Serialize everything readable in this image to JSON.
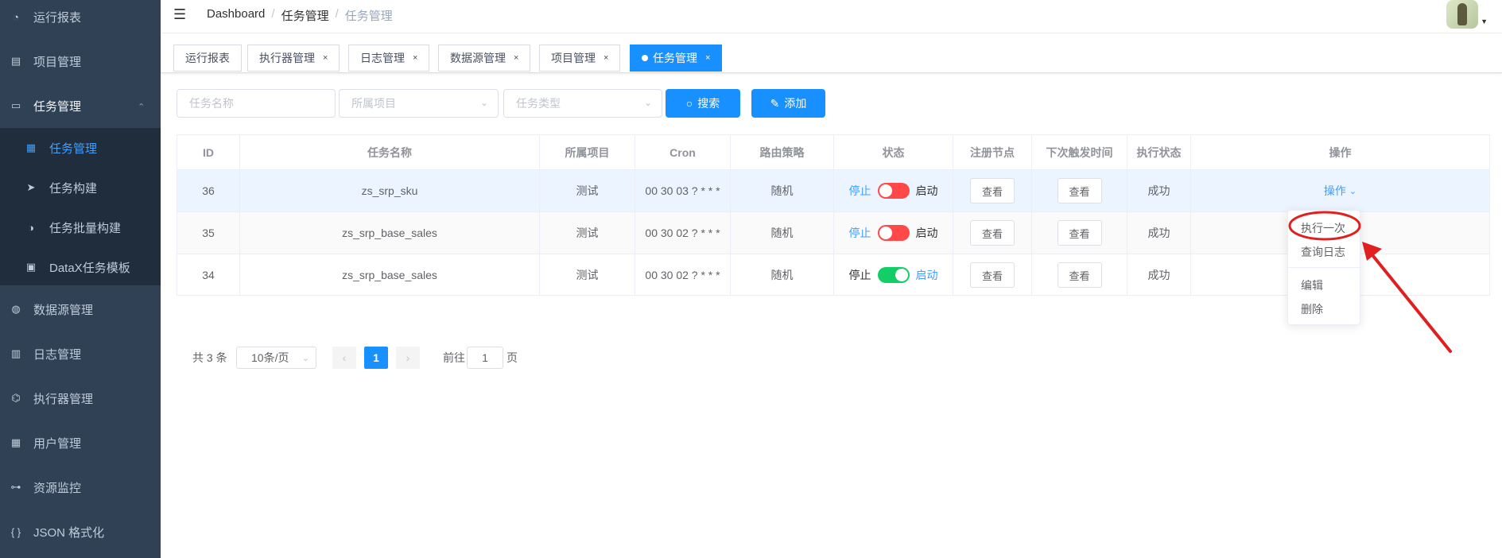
{
  "sidebar": {
    "items": [
      {
        "label": "运行报表",
        "icon": "dashboard-icon"
      },
      {
        "label": "项目管理",
        "icon": "database-icon"
      },
      {
        "label": "任务管理",
        "icon": "monitor-icon"
      },
      {
        "label": "数据源管理",
        "icon": "datasource-icon"
      },
      {
        "label": "日志管理",
        "icon": "log-icon"
      },
      {
        "label": "执行器管理",
        "icon": "executor-icon"
      },
      {
        "label": "用户管理",
        "icon": "table-icon"
      },
      {
        "label": "资源监控",
        "icon": "link-icon"
      },
      {
        "label": "JSON 格式化",
        "icon": "braces-icon"
      }
    ],
    "submenu": [
      {
        "label": "任务管理",
        "icon": "task-icon"
      },
      {
        "label": "任务构建",
        "icon": "send-icon"
      },
      {
        "label": "任务批量构建",
        "icon": "batch-icon"
      },
      {
        "label": "DataX任务模板",
        "icon": "template-icon"
      }
    ]
  },
  "navbar": {
    "breadcrumb": [
      "Dashboard",
      "任务管理",
      "任务管理"
    ],
    "separator": "/"
  },
  "tags": [
    {
      "label": "运行报表",
      "closable": false
    },
    {
      "label": "执行器管理",
      "closable": true
    },
    {
      "label": "日志管理",
      "closable": true
    },
    {
      "label": "数据源管理",
      "closable": true
    },
    {
      "label": "项目管理",
      "closable": true
    },
    {
      "label": "任务管理",
      "closable": true,
      "active": true
    }
  ],
  "filters": {
    "task_name_placeholder": "任务名称",
    "project_placeholder": "所属项目",
    "type_placeholder": "任务类型",
    "search_label": "搜索",
    "add_label": "添加"
  },
  "table": {
    "headers": [
      "ID",
      "任务名称",
      "所属项目",
      "Cron",
      "路由策略",
      "状态",
      "注册节点",
      "下次触发时间",
      "执行状态",
      "操作"
    ],
    "rows": [
      {
        "id": "36",
        "name": "zs_srp_sku",
        "project": "测试",
        "cron": "00 30 03 ? * * *",
        "route": "随机",
        "stop": "停止",
        "start": "启动",
        "running": false,
        "node": "查看",
        "next": "查看",
        "status": "成功",
        "op": "操作"
      },
      {
        "id": "35",
        "name": "zs_srp_base_sales",
        "project": "测试",
        "cron": "00 30 02 ? * * *",
        "route": "随机",
        "stop": "停止",
        "start": "启动",
        "running": false,
        "node": "查看",
        "next": "查看",
        "status": "成功",
        "op": ""
      },
      {
        "id": "34",
        "name": "zs_srp_base_sales",
        "project": "测试",
        "cron": "00 30 02 ? * * *",
        "route": "随机",
        "stop": "停止",
        "start": "启动",
        "running": true,
        "node": "查看",
        "next": "查看",
        "status": "成功",
        "op": ""
      }
    ]
  },
  "dropdown": {
    "items": [
      "执行一次",
      "查询日志",
      "编辑",
      "删除"
    ]
  },
  "pagination": {
    "total": "共 3 条",
    "page_size": "10条/页",
    "current": "1",
    "goto_prefix": "前往",
    "goto_value": "1",
    "goto_suffix": "页"
  },
  "colors": {
    "sidebar_bg": "#304156",
    "submenu_bg": "#1f2d3d",
    "primary": "#1890ff",
    "switch_off": "#ff4949",
    "switch_on": "#13ce66",
    "annotation": "#e02020"
  }
}
